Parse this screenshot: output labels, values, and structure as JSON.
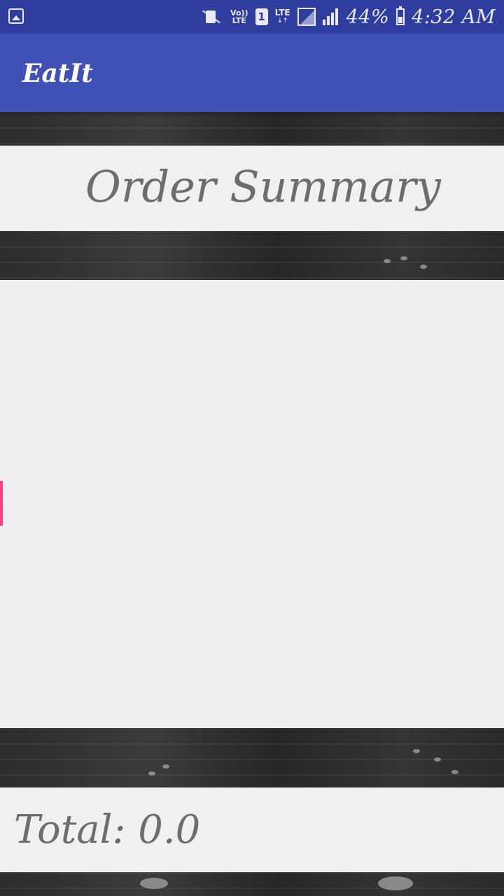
{
  "status_bar": {
    "volte_top": "Vo))",
    "volte_bottom": "LTE",
    "sim_slot": "1",
    "network": "LTE",
    "battery": "44%",
    "time": "4:32 AM"
  },
  "app_bar": {
    "title": "EatIt"
  },
  "order_summary": {
    "title": "Order Summary",
    "items": []
  },
  "total": {
    "label": "Total: 0.0"
  },
  "colors": {
    "status_bar": "#2f3e9e",
    "app_bar": "#3f51b5",
    "panel": "#f0f0f0",
    "text": "#6d6d6d",
    "accent": "#ff4081"
  }
}
